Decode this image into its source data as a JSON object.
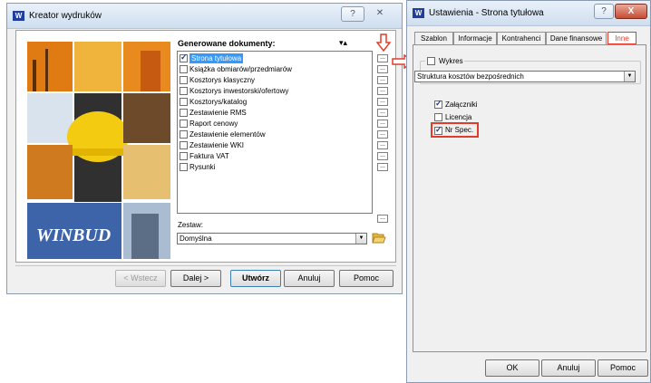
{
  "left_window": {
    "title": "Kreator wydruków",
    "help_button": "?",
    "close_button": "✕",
    "logo_text": "WINBUD",
    "documents_header": "Generowane dokumenty:",
    "sort_arrows": "▾▴",
    "documents": [
      {
        "label": "Strona tytułowa",
        "checked": true,
        "selected": true
      },
      {
        "label": "Książka obmiarów/przedmiarów",
        "checked": false,
        "selected": false
      },
      {
        "label": "Kosztorys klasyczny",
        "checked": false,
        "selected": false
      },
      {
        "label": "Kosztorys inwestorski/ofertowy",
        "checked": false,
        "selected": false
      },
      {
        "label": "Kosztorys/katalog",
        "checked": false,
        "selected": false
      },
      {
        "label": "Zestawienie RMS",
        "checked": false,
        "selected": false
      },
      {
        "label": "Raport cenowy",
        "checked": false,
        "selected": false
      },
      {
        "label": "Zestawienie elementów",
        "checked": false,
        "selected": false
      },
      {
        "label": "Zestawienie WKI",
        "checked": false,
        "selected": false
      },
      {
        "label": "Faktura VAT",
        "checked": false,
        "selected": false
      },
      {
        "label": "Rysunki",
        "checked": false,
        "selected": false
      }
    ],
    "dots_label": "...",
    "set_label": "Zestaw:",
    "set_value": "Domyślna",
    "buttons": {
      "back": "< Wstecz",
      "next": "Dalej >",
      "create": "Utwórz",
      "cancel": "Anuluj",
      "help": "Pomoc"
    }
  },
  "right_window": {
    "title": "Ustawienia - Strona tytułowa",
    "help_button": "?",
    "close_button": "X",
    "tabs": [
      {
        "label": "Szablon",
        "active": false
      },
      {
        "label": "Informacje",
        "active": false
      },
      {
        "label": "Kontrahenci",
        "active": false
      },
      {
        "label": "Dane finansowe",
        "active": false
      },
      {
        "label": "Inne",
        "active": true
      }
    ],
    "chart_checkbox_label": "Wykres",
    "chart_type_value": "Struktura kosztów bezpośrednich",
    "options": [
      {
        "label": "Załączniki",
        "checked": true
      },
      {
        "label": "Licencja",
        "checked": false
      },
      {
        "label": "Nr Spec.",
        "checked": true,
        "highlighted": true
      }
    ],
    "buttons": {
      "ok": "OK",
      "cancel": "Anuluj",
      "help": "Pomoc"
    }
  },
  "colors": {
    "highlight": "#e23b2a",
    "selection": "#3399ff",
    "arrow": "#e23b2a"
  }
}
